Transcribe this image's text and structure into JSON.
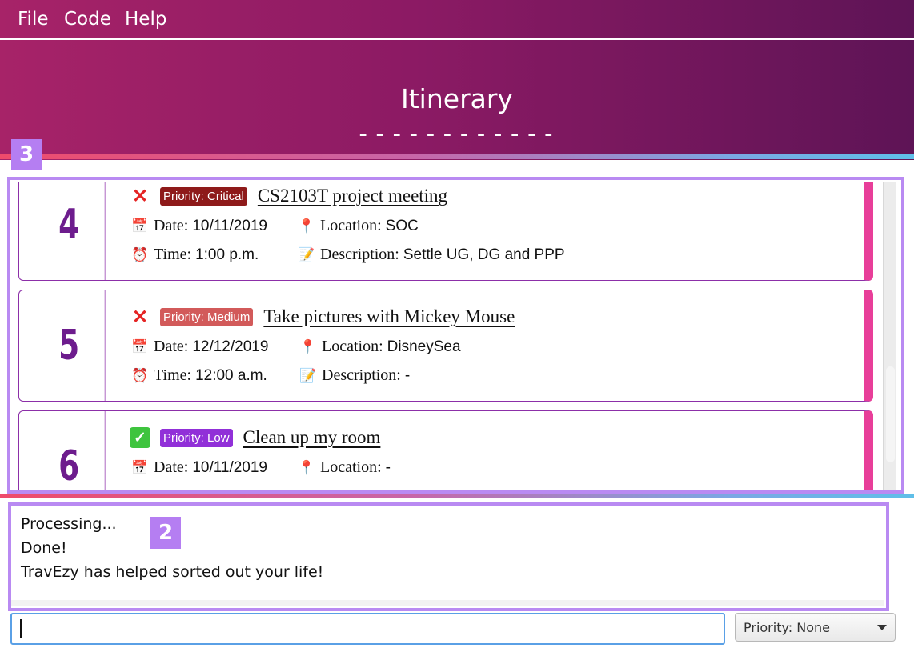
{
  "menu": {
    "items": [
      "File",
      "Code",
      "Help"
    ]
  },
  "header": {
    "title": "Itinerary",
    "rule": "------------"
  },
  "annotations": {
    "list_badge": "3",
    "result_badge": "2"
  },
  "colors": {
    "priority_critical": "#8e1a1a",
    "priority_medium": "#d25a5a",
    "priority_low": "#9130d8",
    "index_color": "#6d1c8d",
    "card_accent": "#e83e99"
  },
  "events": [
    {
      "index": "4",
      "status_icon": "cross-icon",
      "priority": "Priority: Critical",
      "priority_color": "#8e1a1a",
      "name": "CS2103T project meeting",
      "date_label": "Date:",
      "date": "10/11/2019",
      "location_label": "Location:",
      "location": "SOC",
      "time_label": "Time:",
      "time": "1:00 p.m.",
      "description_label": "Description:",
      "description": "Settle UG, DG and PPP"
    },
    {
      "index": "5",
      "status_icon": "cross-icon",
      "priority": "Priority: Medium",
      "priority_color": "#d25a5a",
      "name": "Take pictures with Mickey Mouse",
      "date_label": "Date:",
      "date": "12/12/2019",
      "location_label": "Location:",
      "location": "DisneySea",
      "time_label": "Time:",
      "time": "12:00 a.m.",
      "description_label": "Description:",
      "description": "-"
    },
    {
      "index": "6",
      "status_icon": "check-icon",
      "priority": "Priority: Low",
      "priority_color": "#9130d8",
      "name": "Clean up my room",
      "date_label": "Date:",
      "date": "10/11/2019",
      "location_label": "Location:",
      "location": "-"
    }
  ],
  "result": {
    "lines": [
      "Processing...",
      "Done!",
      "TravEzy has helped sorted out your life!"
    ]
  },
  "command": {
    "value": "",
    "placeholder": ""
  },
  "priority_select": {
    "selected": "Priority: None"
  }
}
